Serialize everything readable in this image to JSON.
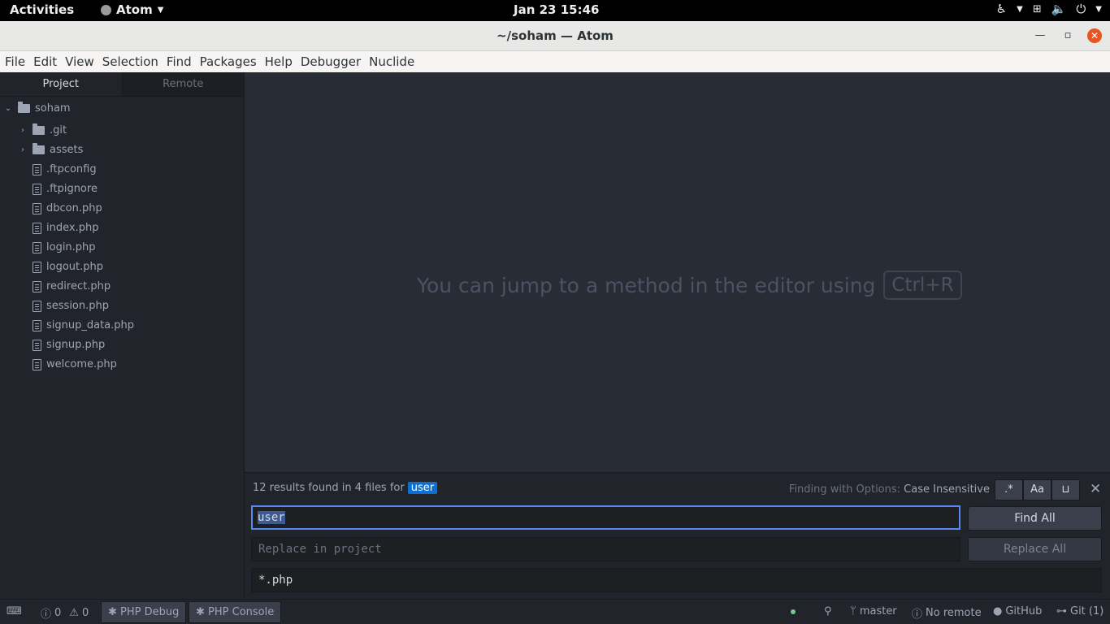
{
  "system_bar": {
    "activities": "Activities",
    "app_name": "Atom",
    "clock": "Jan 23  15:46"
  },
  "window": {
    "title": "~/soham — Atom"
  },
  "menu": [
    "File",
    "Edit",
    "View",
    "Selection",
    "Find",
    "Packages",
    "Help",
    "Debugger",
    "Nuclide"
  ],
  "sidebar": {
    "tabs": [
      "Project",
      "Remote"
    ],
    "root": "soham",
    "folders": [
      ".git",
      "assets"
    ],
    "files": [
      ".ftpconfig",
      ".ftpignore",
      "dbcon.php",
      "index.php",
      "login.php",
      "logout.php",
      "redirect.php",
      "session.php",
      "signup_data.php",
      "signup.php",
      "welcome.php"
    ]
  },
  "editor": {
    "hint": "You can jump to a method in the editor using",
    "shortcut": "Ctrl+R"
  },
  "find": {
    "results_text": "12 results found in 4 files for",
    "query_badge": "user",
    "options_label": "Finding with Options:",
    "options_value": "Case Insensitive",
    "opt_regex": ".*",
    "opt_case": "Aa",
    "opt_word": "⊔",
    "search_value": "user",
    "replace_placeholder": "Replace in project",
    "paths_value": "*.php",
    "find_all": "Find All",
    "replace_all": "Replace All"
  },
  "status": {
    "errors": "0",
    "warnings": "0",
    "php_debug": "PHP Debug",
    "php_console": "PHP Console",
    "branch": "master",
    "remote": "No remote",
    "github": "GitHub",
    "git": "Git (1)"
  }
}
